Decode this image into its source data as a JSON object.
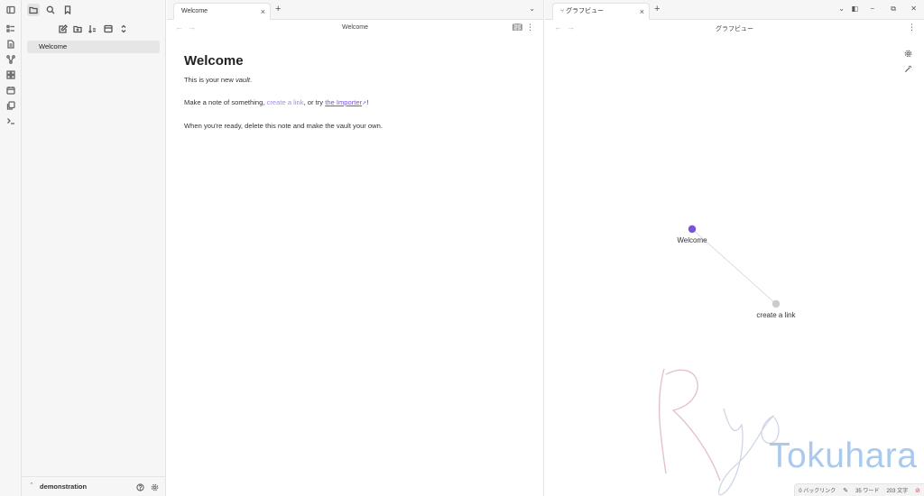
{
  "sidebar": {
    "files": [
      {
        "name": "Welcome"
      }
    ],
    "vault_name": "demonstration"
  },
  "tabs_left": [
    {
      "label": "Welcome"
    }
  ],
  "tabs_right": [
    {
      "label": "グラフビュー"
    }
  ],
  "pane_left": {
    "header_title": "Welcome",
    "doc": {
      "heading": "Welcome",
      "p1_prefix": "This is your new ",
      "p1_em": "vault",
      "p1_suffix": ".",
      "p2_prefix": "Make a note of something, ",
      "p2_link1": "create a link",
      "p2_mid": ", or try ",
      "p2_link2": "the Importer",
      "p2_suffix": "!",
      "p3": "When you're ready, delete this note and make the vault your own."
    }
  },
  "pane_right": {
    "header_title": "グラフビュー",
    "graph": {
      "nodes": [
        {
          "id": "welcome",
          "label": "Welcome",
          "color": "#7b53d9"
        },
        {
          "id": "create-a-link",
          "label": "create a link",
          "color": "#cccccc"
        }
      ],
      "edges": [
        {
          "from": "welcome",
          "to": "create-a-link"
        }
      ]
    }
  },
  "watermark": {
    "script": "Ryo",
    "name": "Tokuhara"
  },
  "status": {
    "backlinks": "0 バックリンク",
    "words": "35 ワード",
    "chars": "203 文字"
  },
  "colors": {
    "accent": "#7b53d9",
    "watermark_blue": "#a9c9ee",
    "watermark_pink": "#e3c3c8"
  }
}
